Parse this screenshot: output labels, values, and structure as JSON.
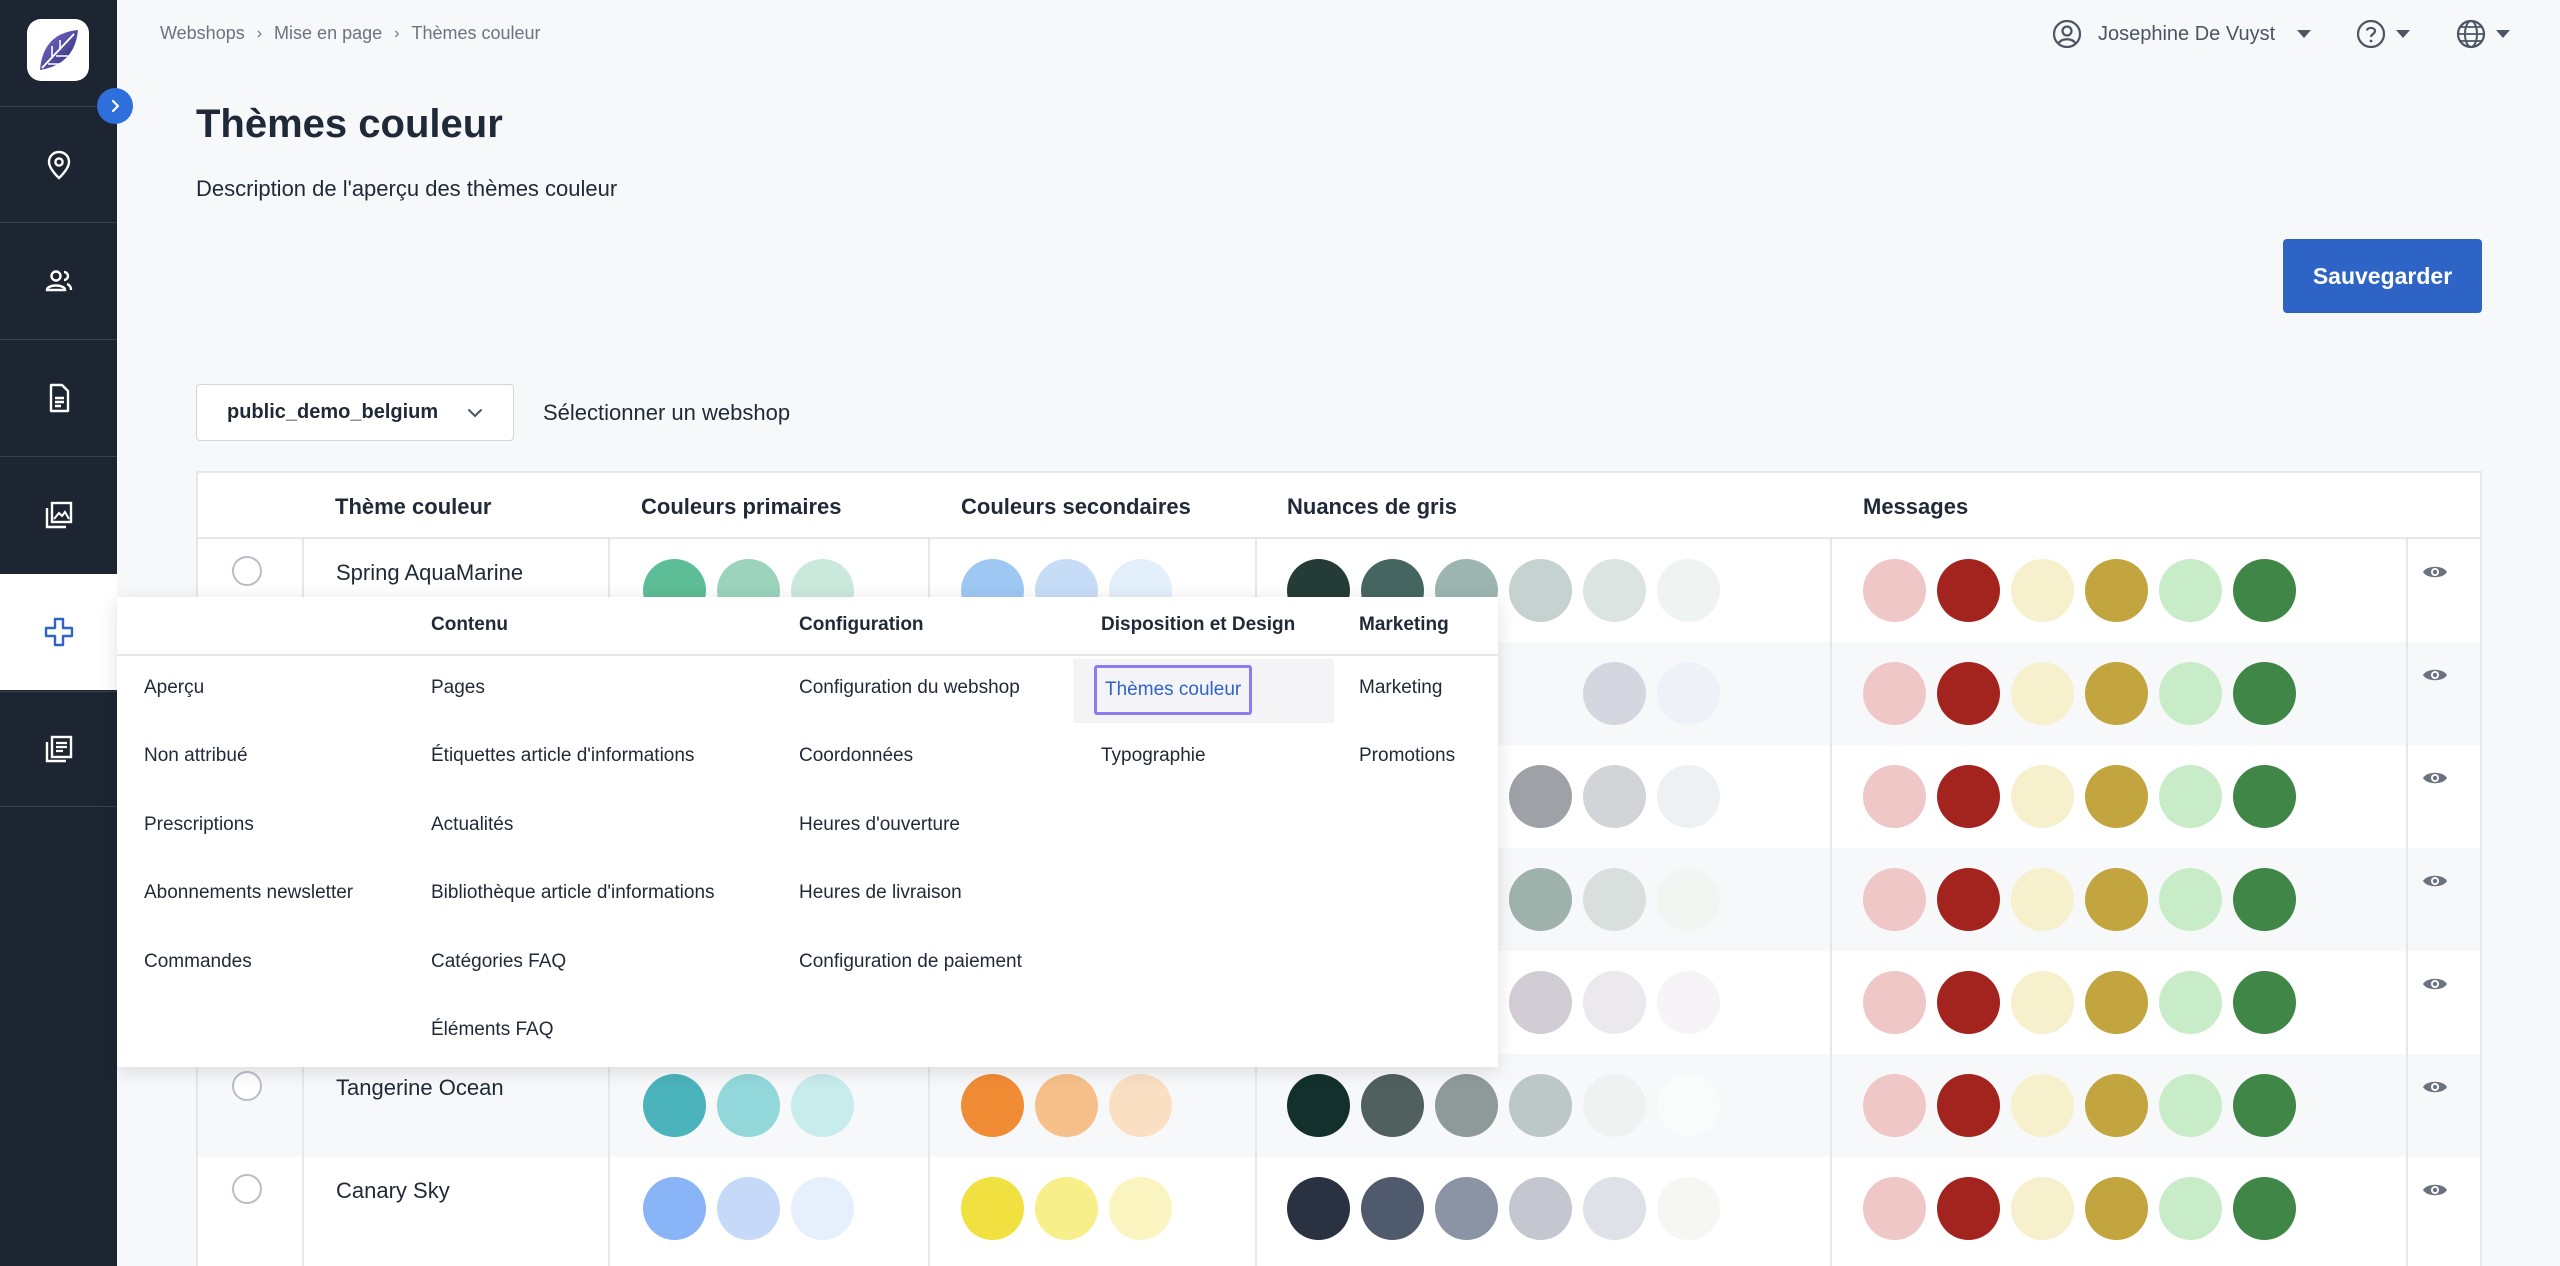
{
  "breadcrumb": [
    "Webshops",
    "Mise en page",
    "Thèmes couleur"
  ],
  "user": {
    "name": "Josephine De Vuyst"
  },
  "page": {
    "title": "Thèmes couleur",
    "description": "Description de l'aperçu des thèmes couleur",
    "save_label": "Sauvegarder"
  },
  "webshop_select": {
    "value": "public_demo_belgium",
    "label": "Sélectionner un webshop"
  },
  "table": {
    "headers": [
      "Thème couleur",
      "Couleurs primaires",
      "Couleurs secondaires",
      "Nuances de gris",
      "Messages"
    ],
    "rows": [
      {
        "name": "Spring AquaMarine",
        "primary": [
          "#5dbd96",
          "#9cd3bd",
          "#cbe8dc"
        ],
        "secondary": [
          "#9ec8f3",
          "#c7ddf7",
          "#e3effb"
        ],
        "grays": [
          "#243c35",
          "#456660",
          "#9db5b0",
          "#c5d2cf",
          "#dbe4e1",
          "#eff4f2"
        ]
      },
      {
        "name": "",
        "primary": [],
        "secondary": [],
        "grays": [
          "#d5d7e0",
          "#eff1f9"
        ]
      },
      {
        "name": "",
        "primary": [],
        "secondary": [],
        "grays": [
          "#9ea1a6",
          "#d3d4d8",
          "#edf1f4"
        ]
      },
      {
        "name": "",
        "primary": [],
        "secondary": [],
        "grays": [
          "#9fb1ab",
          "#d9dfdc",
          "#f1f6f3"
        ]
      },
      {
        "name": "",
        "primary": [],
        "secondary": [],
        "grays": [
          "#d2cdd4",
          "#ece9ee",
          "#f6f4f7"
        ]
      },
      {
        "name": "Tangerine Ocean",
        "primary": [
          "#4ab3bc",
          "#92d8db",
          "#c8ebec"
        ],
        "secondary": [
          "#f08c34",
          "#f7c08a",
          "#fbdfc3"
        ],
        "grays": [
          "#13302d",
          "#50605e",
          "#8e9a99",
          "#bcc8c7",
          "#eef3f2",
          "#fafcfb"
        ]
      },
      {
        "name": "Canary Sky",
        "primary": [
          "#8ab4f8",
          "#c6d9f8",
          "#e6effc"
        ],
        "secondary": [
          "#f0e040",
          "#f6ef8a",
          "#faf5c0"
        ],
        "grays": [
          "#2a3242",
          "#4f5a6d",
          "#8a94a4",
          "#c4c7cf",
          "#dfe1e8",
          "#f6f7f2"
        ]
      }
    ],
    "messages": [
      "#f0c7c7",
      "#a3241e",
      "#f7f0cc",
      "#c2a53e",
      "#c9ecc8",
      "#3f8647"
    ]
  },
  "mega_menu": {
    "columns": [
      {
        "heading": "",
        "items": [
          "Aperçu",
          "Non attribué",
          "Prescriptions",
          "Abonnements newsletter",
          "Commandes"
        ]
      },
      {
        "heading": "Contenu",
        "items": [
          "Pages",
          "Étiquettes article d'informations",
          "Actualités",
          "Bibliothèque article d'informations",
          "Catégories FAQ",
          "Éléments FAQ"
        ]
      },
      {
        "heading": "Configuration",
        "items": [
          "Configuration du webshop",
          "Coordonnées",
          "Heures d'ouverture",
          "Heures de livraison",
          "Configuration de paiement"
        ]
      },
      {
        "heading": "Disposition et Design",
        "items": [
          "Thèmes couleur",
          "Typographie"
        ]
      },
      {
        "heading": "Marketing",
        "items": [
          "Marketing",
          "Promotions"
        ]
      }
    ]
  },
  "icons": {
    "nav": [
      "location-pin-icon",
      "users-icon",
      "document-icon",
      "image-icon",
      "plus-icon",
      "list-icon"
    ],
    "top": [
      "user-circle-icon",
      "help-icon",
      "globe-icon"
    ]
  },
  "colors": {
    "accent": "#2f64c7",
    "sidebar": "#1d2532",
    "focus": "#8b7cf0"
  }
}
